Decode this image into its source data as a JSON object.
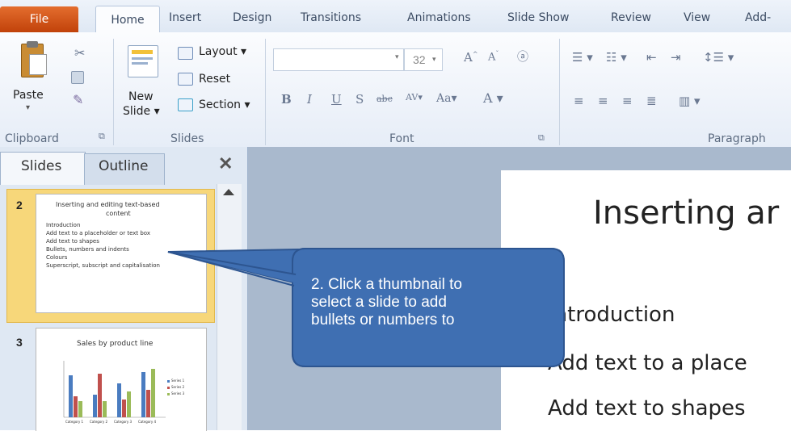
{
  "ribbon": {
    "tabs": [
      "File",
      "Home",
      "Insert",
      "Design",
      "Transitions",
      "Animations",
      "Slide Show",
      "Review",
      "View",
      "Add-"
    ],
    "clipboard": {
      "paste": "Paste",
      "group": "Clipboard"
    },
    "slides": {
      "new_slide_line1": "New",
      "new_slide_line2": "Slide",
      "layout": "Layout",
      "reset": "Reset",
      "section": "Section",
      "group": "Slides"
    },
    "font": {
      "size": "32",
      "group": "Font"
    },
    "paragraph": {
      "group": "Paragraph"
    }
  },
  "left_pane": {
    "tabs": [
      "Slides",
      "Outline"
    ],
    "thumb2": {
      "number": "2",
      "title_line1": "Inserting and editing text-based",
      "title_line2": "content",
      "bullets": [
        "Introduction",
        "Add text to a placeholder or text box",
        "Add text to shapes",
        "Bullets, numbers and indents",
        "Colours",
        "Superscript, subscript and capitalisation"
      ]
    },
    "thumb3": {
      "number": "3",
      "title": "Sales by product line",
      "categories": [
        "Category 1",
        "Category 2",
        "Category 3",
        "Category 4"
      ],
      "legend": [
        "Series 1",
        "Series 2",
        "Series 3"
      ]
    }
  },
  "slide": {
    "title": "Inserting ar",
    "lines": [
      "Introduction",
      "Add text to a place",
      "Add text to shapes"
    ]
  },
  "callout": {
    "text_line1": "2. Click a thumbnail to",
    "text_line2": "select a slide to add",
    "text_line3": "bullets or numbers to"
  },
  "colors": {
    "file_tab": "#d35a1b",
    "callout_fill": "#3f6fb2",
    "thumb_selected": "#f7d77a"
  }
}
